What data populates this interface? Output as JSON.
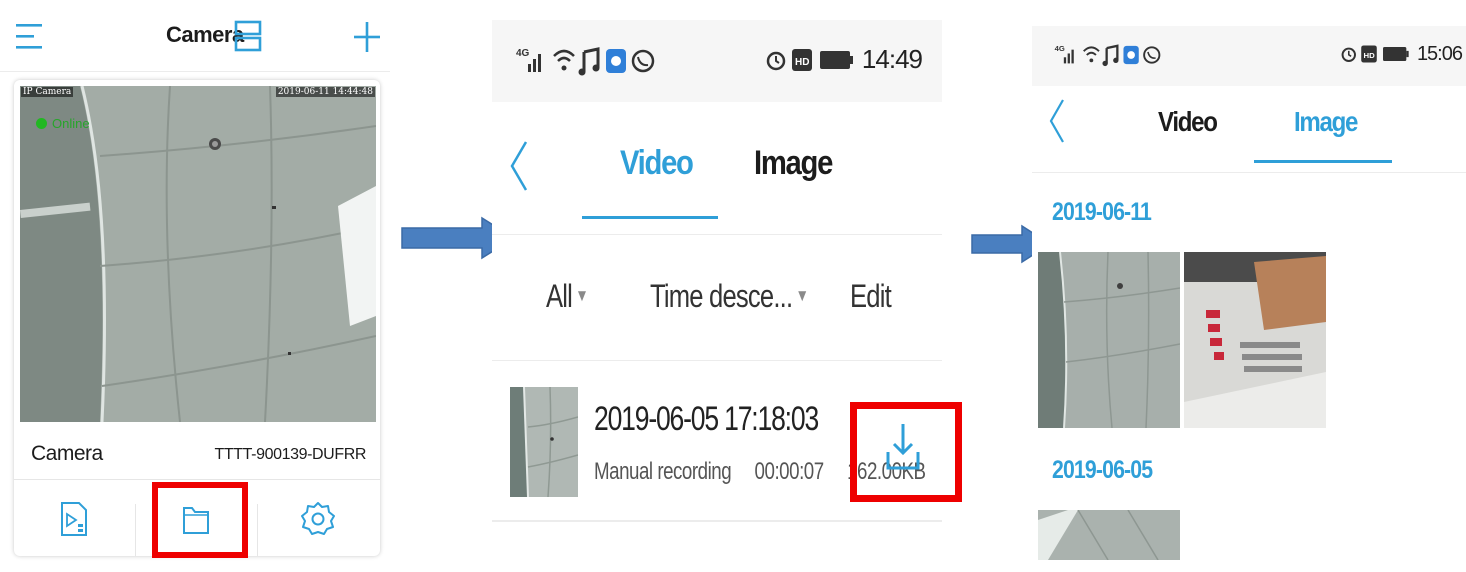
{
  "panel1": {
    "header": {
      "title": "Camera",
      "menu_icon": "menu-icon",
      "layout_icon": "grid-layout-icon",
      "add_icon": "plus-icon"
    },
    "camera": {
      "osd_label": "IP Camera",
      "osd_timestamp": "2019-06-11 14:44:48",
      "status": "Online",
      "name": "Camera",
      "device_id": "TTTT-900139-DUFRR"
    },
    "actions": [
      {
        "icon": "video-playback-icon"
      },
      {
        "icon": "folder-icon",
        "highlighted": true
      },
      {
        "icon": "gear-icon"
      }
    ]
  },
  "panel2": {
    "status_bar": {
      "network": "4G",
      "time": "14:49"
    },
    "tabs": {
      "video": "Video",
      "image": "Image",
      "active": "video"
    },
    "filters": {
      "all": "All",
      "sort": "Time desce...",
      "edit": "Edit"
    },
    "recording": {
      "datetime": "2019-06-05 17:18:03",
      "type": "Manual recording",
      "duration": "00:00:07",
      "size": "162.00KB",
      "action_icon": "download-icon",
      "highlighted": true
    }
  },
  "panel3": {
    "status_bar": {
      "network": "4G",
      "time": "15:06"
    },
    "tabs": {
      "video": "Video",
      "image": "Image",
      "active": "image"
    },
    "groups": [
      {
        "date": "2019-06-11",
        "images": 2
      },
      {
        "date": "2019-06-05",
        "images": 1
      }
    ]
  },
  "colors": {
    "accent": "#2f9fd8",
    "highlight": "#ee0000",
    "arrow": "#4a7fc0",
    "online": "#22b822"
  }
}
